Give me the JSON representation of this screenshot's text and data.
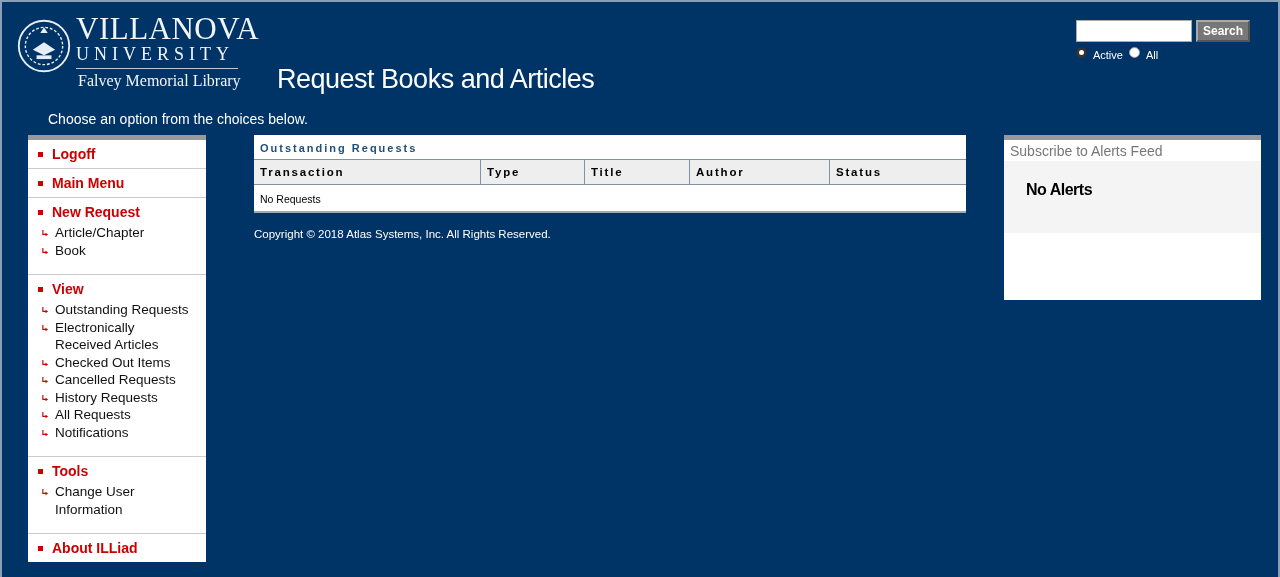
{
  "logo": {
    "name": "VILLANOVA",
    "subname": "UNIVERSITY",
    "library": "Falvey Memorial Library"
  },
  "page_title": "Request Books and Articles",
  "search": {
    "button": "Search",
    "options": [
      {
        "label": "Active",
        "selected": true
      },
      {
        "label": "All",
        "selected": false
      }
    ]
  },
  "intro": "Choose an option from the choices below.",
  "sidebar": [
    {
      "label": "Logoff"
    },
    {
      "label": "Main Menu"
    },
    {
      "label": "New Request",
      "children": [
        "Article/Chapter",
        "Book"
      ]
    },
    {
      "label": "View",
      "children": [
        "Outstanding Requests",
        "Electronically Received Articles",
        "Checked Out Items",
        "Cancelled Requests",
        "History Requests",
        "All Requests",
        "Notifications"
      ]
    },
    {
      "label": "Tools",
      "children": [
        "Change User Information"
      ]
    },
    {
      "label": "About ILLiad"
    }
  ],
  "table": {
    "title": "Outstanding Requests",
    "columns": [
      "Transaction",
      "Type",
      "Title",
      "Author",
      "Status"
    ],
    "empty": "No Requests"
  },
  "copyright": "Copyright © 2018 Atlas Systems, Inc. All Rights Reserved.",
  "alerts": {
    "title": "Subscribe to Alerts Feed",
    "message": "No Alerts"
  }
}
